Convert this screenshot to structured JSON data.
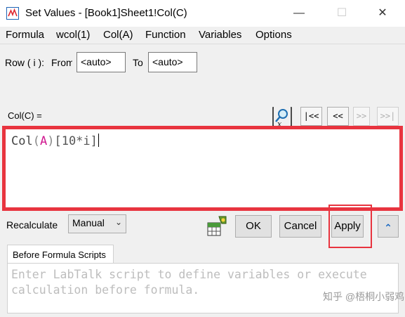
{
  "window": {
    "title": "Set Values - [Book1]Sheet1!Col(C)",
    "minimize_glyph": "—",
    "maximize_glyph": "☐",
    "close_glyph": "✕"
  },
  "menu": [
    "Formula",
    "wcol(1)",
    "Col(A)",
    "Function",
    "Variables",
    "Options"
  ],
  "row_range": {
    "label": "Row ( i ):",
    "from_label": "From",
    "from_value": "<auto>",
    "to_label": "To",
    "to_value": "<auto>"
  },
  "col_label": "Col(C) =",
  "nav": [
    "|<<",
    "<<",
    ">>",
    ">>|"
  ],
  "formula": {
    "p1": "Col",
    "p2": "(",
    "p3": "A",
    "p4": ")",
    "p5": "[10*i]"
  },
  "recalculate": {
    "label": "Recalculate",
    "value": "Manual"
  },
  "buttons": {
    "ok": "OK",
    "cancel": "Cancel",
    "apply": "Apply",
    "collapse": "⌃"
  },
  "scripts": {
    "tab_label": "Before Formula Scripts",
    "placeholder": "Enter LabTalk script to define variables or execute calculation before formula."
  },
  "watermark": "知乎 @梧桐小弱鸡",
  "colors": {
    "highlight": "#e8343f",
    "accent": "#1565c0"
  },
  "icons": [
    "app-icon",
    "search-function-icon",
    "formula-builder-icon",
    "collapse-icon"
  ]
}
